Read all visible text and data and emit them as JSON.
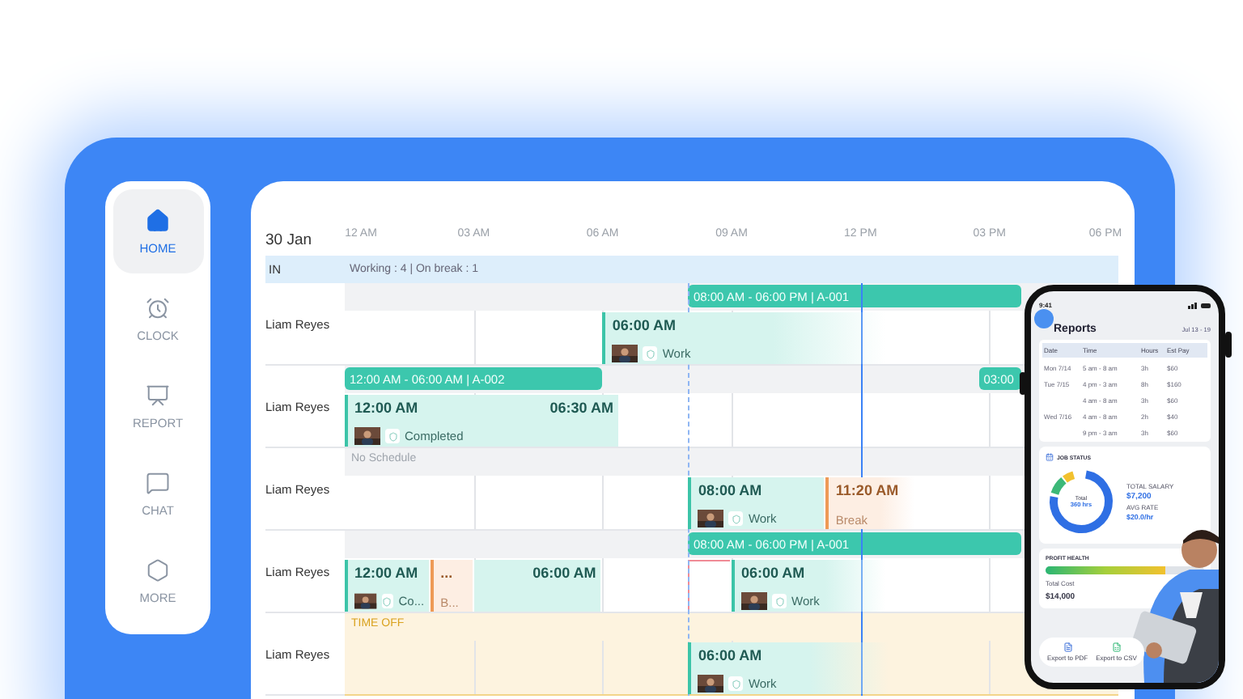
{
  "nav": [
    {
      "label": "HOME",
      "selected": true
    },
    {
      "label": "CLOCK",
      "selected": false
    },
    {
      "label": "REPORT",
      "selected": false
    },
    {
      "label": "CHAT",
      "selected": false
    },
    {
      "label": "MORE",
      "selected": false
    }
  ],
  "timeline": {
    "date": "30 Jan",
    "ticks": [
      "12 AM",
      "03 AM",
      "06 AM",
      "09 AM",
      "12 PM",
      "03 PM",
      "06 PM"
    ],
    "summary": {
      "label": "IN",
      "text": "Working : 4 | On break : 1"
    },
    "rows": [
      {
        "name": "Liam Reyes",
        "lane": {
          "kind": "bars",
          "bars": [
            "08:00 AM - 06:00 PM | A-001"
          ]
        },
        "entries": [
          {
            "kind": "shift",
            "time": "06:00 AM",
            "status": "Work"
          }
        ]
      },
      {
        "name": "Liam Reyes",
        "lane": {
          "kind": "bars",
          "bars": [
            "12:00 AM - 06:00 AM | A-002",
            "03:00"
          ]
        },
        "entries": [
          {
            "kind": "shift",
            "time": "12:00 AM",
            "end_time": "06:30 AM",
            "status": "Completed"
          }
        ]
      },
      {
        "name": "Liam Reyes",
        "lane": {
          "kind": "note",
          "text": "No Schedule"
        },
        "entries": [
          {
            "kind": "shift",
            "time": "08:00 AM",
            "status": "Work"
          },
          {
            "kind": "break",
            "time": "11:20 AM",
            "status": "Break"
          }
        ]
      },
      {
        "name": "Liam Reyes",
        "lane": {
          "kind": "bars",
          "bars": [
            "08:00 AM - 06:00 PM | A-001"
          ]
        },
        "entries": [
          {
            "kind": "shift",
            "time": "12:00 AM",
            "status": "Co..."
          },
          {
            "kind": "break",
            "time": "...",
            "status": "B..."
          },
          {
            "kind": "shift-end",
            "end_time": "06:00 AM"
          },
          {
            "kind": "late"
          },
          {
            "kind": "shift",
            "time": "06:00 AM",
            "status": "Work"
          }
        ]
      },
      {
        "name": "Liam Reyes",
        "lane": {
          "kind": "timeoff",
          "text": "TIME OFF"
        },
        "entries": [
          {
            "kind": "shift",
            "time": "06:00 AM",
            "status": "Work"
          }
        ]
      }
    ]
  },
  "phone": {
    "clock": "9:41",
    "title": "Reports",
    "range": "Jul 13 - 19",
    "columns": [
      "Date",
      "Time",
      "Hours",
      "Est Pay"
    ],
    "rows": [
      [
        "Mon 7/14",
        "5 am - 8 am",
        "3h",
        "$60"
      ],
      [
        "Tue 7/15",
        "4 pm - 3 am",
        "8h",
        "$160"
      ],
      [
        "",
        "4 am - 8 am",
        "3h",
        "$60"
      ],
      [
        "Wed 7/16",
        "4 am - 8 am",
        "2h",
        "$40"
      ],
      [
        "",
        "9 pm - 3 am",
        "3h",
        "$60"
      ]
    ],
    "job_status": {
      "title": "JOB STATUS",
      "donut_label": "Total",
      "donut_value": "360 hrs",
      "salary_label": "TOTAL SALARY",
      "salary": "$7,200",
      "rate_label": "AVG RATE",
      "rate": "$20.0/hr"
    },
    "profit": {
      "title": "PROFIT HEALTH",
      "level": 0.75,
      "cost_label": "Total Cost",
      "cost": "$14,000"
    },
    "buttons": [
      "Export to PDF",
      "Export to CSV"
    ]
  }
}
